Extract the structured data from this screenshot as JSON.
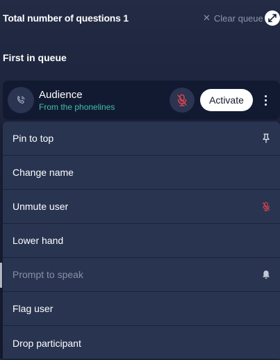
{
  "header": {
    "title": "Total number of questions 1",
    "clear_label": "Clear queue",
    "clear_icon": "close-icon",
    "expand_icon": "expand-icon"
  },
  "queue": {
    "section_label": "First in queue",
    "participant": {
      "name": "Audience",
      "subtitle": "From the phonelines",
      "avatar_icon": "phone-icon",
      "mute_icon": "muted-mic-icon",
      "activate_label": "Activate",
      "more_icon": "more-vertical-icon"
    }
  },
  "menu": {
    "items": [
      {
        "label": "Pin to top",
        "icon": "pin-icon"
      },
      {
        "label": "Change name"
      },
      {
        "label": "Unmute user",
        "icon": "muted-mic-icon"
      },
      {
        "label": "Lower hand"
      },
      {
        "label": "Prompt to speak",
        "icon": "bell-icon",
        "disabled": true
      },
      {
        "label": "Flag user"
      },
      {
        "label": "Drop participant"
      }
    ]
  },
  "colors": {
    "background": "#1b2239",
    "card": "#121a32",
    "menu": "#283450",
    "accent_green": "#3fc0a3",
    "muted_red": "#e0454f"
  }
}
